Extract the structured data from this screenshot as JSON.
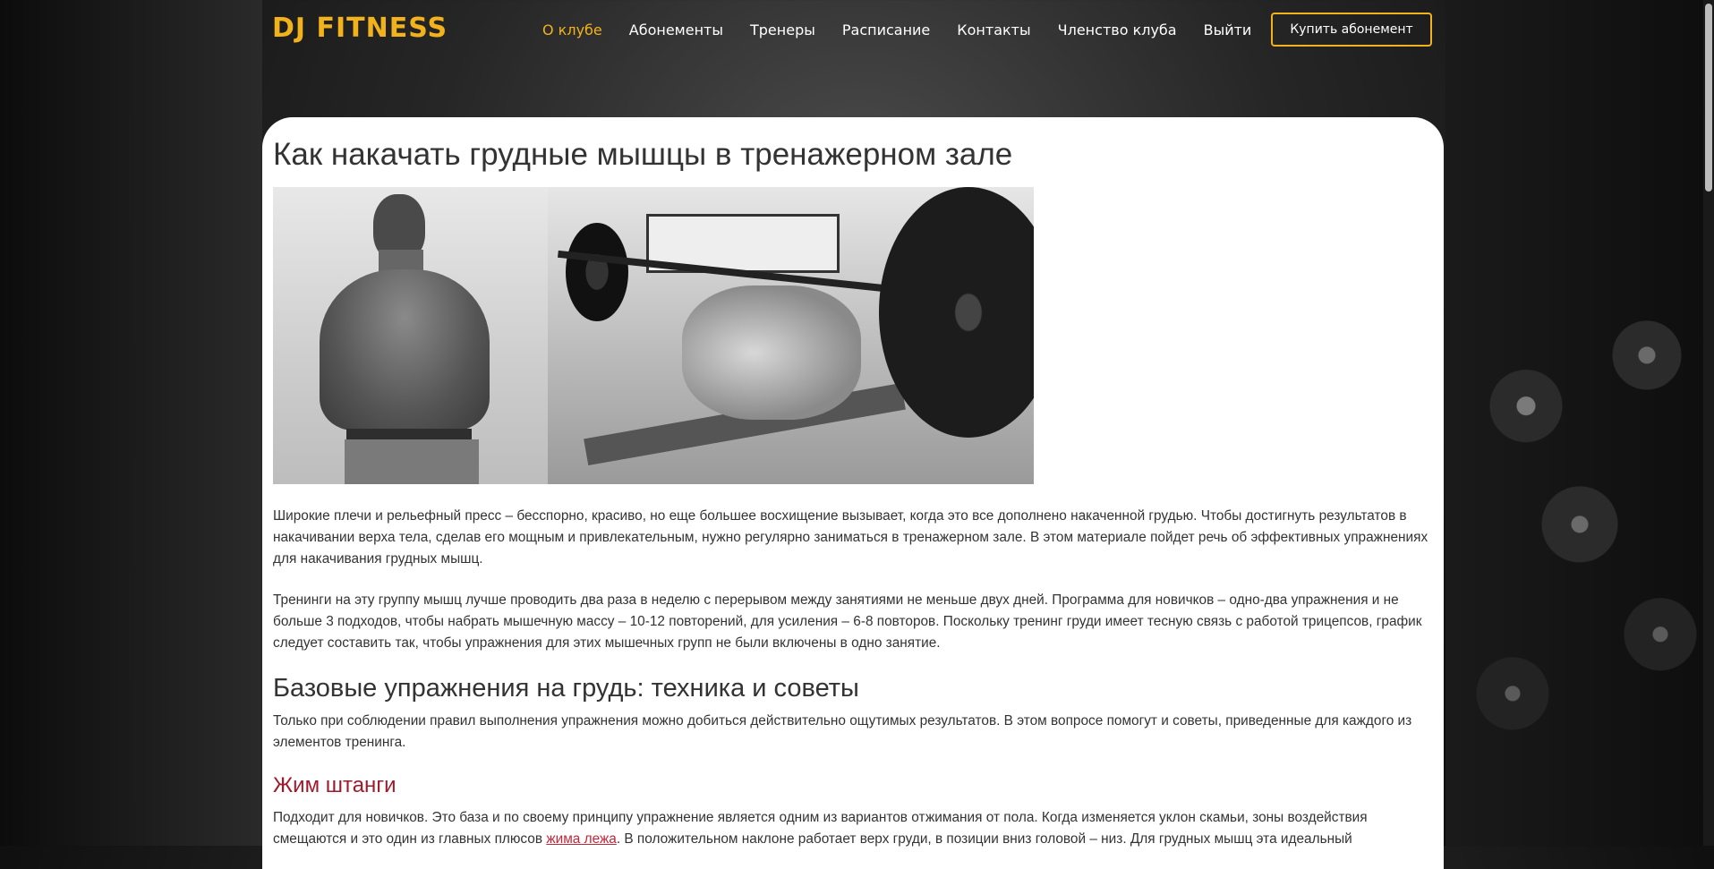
{
  "header": {
    "logo": "DJ FITNESS",
    "nav": [
      {
        "label": "О клубе",
        "active": true
      },
      {
        "label": "Абонементы",
        "active": false
      },
      {
        "label": "Тренеры",
        "active": false
      },
      {
        "label": "Расписание",
        "active": false
      },
      {
        "label": "Контакты",
        "active": false
      },
      {
        "label": "Членство клуба",
        "active": false
      },
      {
        "label": "Выйти",
        "active": false
      }
    ],
    "buy_button": "Купить абонемент"
  },
  "article": {
    "title": "Как накачать грудные мышцы в тренажерном зале",
    "para1": "Широкие плечи и рельефный пресс – бесспорно, красиво, но еще большее восхищение вызывает, когда это все дополнено накаченной грудью. Чтобы достигнуть результатов в накачивании верха тела, сделав его мощным и привлекательным, нужно регулярно заниматься в тренажерном зале. В этом материале пойдет речь об эффективных упражнениях для накачивания грудных мышц.",
    "para2": "Тренинги на эту группу мышц лучше проводить два раза в неделю с перерывом между занятиями не меньше двух дней. Программа для новичков – одно-два упражнения и не больше 3 подходов, чтобы набрать мышечную массу – 10-12 повторений, для усиления – 6-8 повторов. Поскольку тренинг груди имеет тесную связь с работой трицепсов, график следует составить так, чтобы упражнения для этих мышечных групп не были включены в одно занятие.",
    "section_title": "Базовые упражнения на грудь: техника и советы",
    "section_text": "Только при соблюдении правил выполнения упражнения можно добиться действительно ощутимых результатов. В этом вопросе помогут и советы, приведенные для каждого из элементов тренинга.",
    "sub_title": "Жим штанги",
    "para3_start": "Подходит для новичков. Это база и по своему принципу упражнение является одним из вариантов отжимания от пола. Когда изменяется уклон скамьи, зоны воздействия смещаются и это один из главных плюсов ",
    "para3_link": "жима лежа",
    "para3_end": ". В положительном наклоне работает верх груди, в позиции вниз головой – низ. Для грудных мышц эта идеальный"
  },
  "colors": {
    "accent": "#f2b21c",
    "link": "#c0283a",
    "subheading": "#a0192b"
  }
}
